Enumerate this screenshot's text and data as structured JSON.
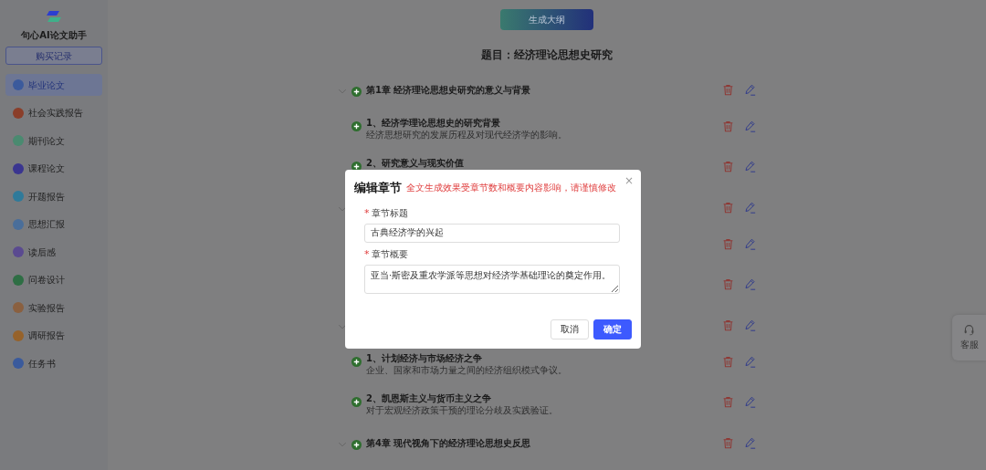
{
  "sidebar": {
    "app_name": "句心AI论文助手",
    "purchase_button": "购买记录",
    "items": [
      {
        "label": "毕业论文",
        "selected": true,
        "color": "#3b5a9c"
      },
      {
        "label": "社会实践报告",
        "selected": false,
        "color": "#8a3e2a"
      },
      {
        "label": "期刊论文",
        "selected": false,
        "color": "#4a8a70"
      },
      {
        "label": "课程论文",
        "selected": false,
        "color": "#3a3590"
      },
      {
        "label": "开题报告",
        "selected": false,
        "color": "#2f7a9a"
      },
      {
        "label": "思想汇报",
        "selected": false,
        "color": "#4a6e9a"
      },
      {
        "label": "读后感",
        "selected": false,
        "color": "#5a4a90"
      },
      {
        "label": "问卷设计",
        "selected": false,
        "color": "#2e6e44"
      },
      {
        "label": "实验报告",
        "selected": false,
        "color": "#8a6040"
      },
      {
        "label": "调研报告",
        "selected": false,
        "color": "#96622a"
      },
      {
        "label": "任务书",
        "selected": false,
        "color": "#3a5a9c"
      }
    ]
  },
  "generate_button": "生成大纲",
  "topic": "题目：经济理论思想史研究",
  "outline": [
    {
      "kind": "chapter",
      "expanded": true,
      "title": "第1章 经济理论思想史研究的意义与背景"
    },
    {
      "kind": "section",
      "title": "1、经济学理论思想史的研究背景",
      "summary": "经济思想研究的发展历程及对现代经济学的影响。"
    },
    {
      "kind": "section",
      "title": "2、研究意义与现实价值"
    },
    {
      "kind": "chapter",
      "expanded": true
    },
    {
      "kind": "section"
    },
    {
      "kind": "section"
    },
    {
      "kind": "chapter",
      "expanded": true
    },
    {
      "kind": "section",
      "title": "1、计划经济与市场经济之争",
      "summary": "企业、国家和市场力量之间的经济组织模式争议。"
    },
    {
      "kind": "section",
      "title": "2、凯恩斯主义与货币主义之争",
      "summary": "对于宏观经济政策干预的理论分歧及实践验证。"
    },
    {
      "kind": "chapter",
      "expanded": true,
      "title": "第4章 现代视角下的经济理论思想史反思"
    }
  ],
  "support": {
    "label": "客服"
  },
  "dialog": {
    "title": "编辑章节",
    "warning": "全文生成效果受章节数和概要内容影响，请谨慎修改",
    "close_symbol": "×",
    "fields": [
      {
        "kind": "input",
        "label": "章节标题",
        "required_mark": "*",
        "value": "古典经济学的兴起"
      },
      {
        "kind": "textarea",
        "label": "章节概要",
        "required_mark": "*",
        "value": "亚当·斯密及重农学派等思想对经济学基础理论的奠定作用。"
      }
    ],
    "buttons": [
      {
        "label": "取消",
        "kind": "secondary"
      },
      {
        "label": "确定",
        "kind": "primary"
      }
    ]
  }
}
